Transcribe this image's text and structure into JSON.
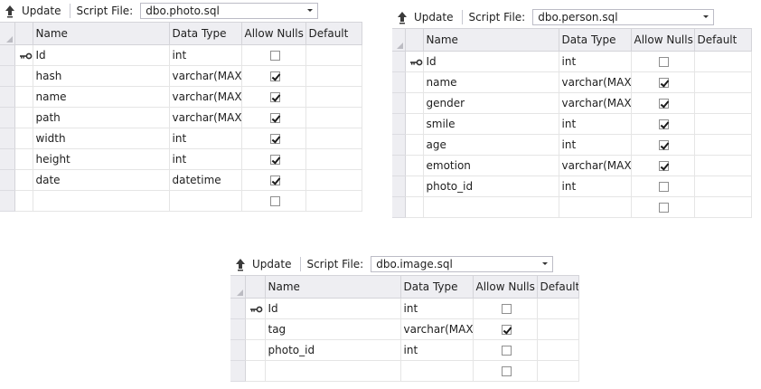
{
  "panels": [
    {
      "id": "photo",
      "toolbar": {
        "update_label": "Update",
        "script_label": "Script File:",
        "script_file": "dbo.photo.sql"
      },
      "columns_header": {
        "name": "Name",
        "data_type": "Data Type",
        "allow_nulls": "Allow Nulls",
        "default": "Default"
      },
      "rows": [
        {
          "key": true,
          "name": "Id",
          "type": "int",
          "nulls": false
        },
        {
          "key": false,
          "name": "hash",
          "type": "varchar(MAX)",
          "nulls": true
        },
        {
          "key": false,
          "name": "name",
          "type": "varchar(MAX)",
          "nulls": true
        },
        {
          "key": false,
          "name": "path",
          "type": "varchar(MAX)",
          "nulls": true
        },
        {
          "key": false,
          "name": "width",
          "type": "int",
          "nulls": true
        },
        {
          "key": false,
          "name": "height",
          "type": "int",
          "nulls": true
        },
        {
          "key": false,
          "name": "date",
          "type": "datetime",
          "nulls": true
        },
        {
          "key": false,
          "name": "",
          "type": "",
          "nulls": false
        }
      ]
    },
    {
      "id": "person",
      "toolbar": {
        "update_label": "Update",
        "script_label": "Script File:",
        "script_file": "dbo.person.sql"
      },
      "columns_header": {
        "name": "Name",
        "data_type": "Data Type",
        "allow_nulls": "Allow Nulls",
        "default": "Default"
      },
      "rows": [
        {
          "key": true,
          "name": "Id",
          "type": "int",
          "nulls": false
        },
        {
          "key": false,
          "name": "name",
          "type": "varchar(MAX)",
          "nulls": true
        },
        {
          "key": false,
          "name": "gender",
          "type": "varchar(MAX)",
          "nulls": true
        },
        {
          "key": false,
          "name": "smile",
          "type": "int",
          "nulls": true
        },
        {
          "key": false,
          "name": "age",
          "type": "int",
          "nulls": true
        },
        {
          "key": false,
          "name": "emotion",
          "type": "varchar(MAX)",
          "nulls": true
        },
        {
          "key": false,
          "name": "photo_id",
          "type": "int",
          "nulls": false
        },
        {
          "key": false,
          "name": "",
          "type": "",
          "nulls": false
        }
      ]
    },
    {
      "id": "image",
      "toolbar": {
        "update_label": "Update",
        "script_label": "Script File:",
        "script_file": "dbo.image.sql"
      },
      "columns_header": {
        "name": "Name",
        "data_type": "Data Type",
        "allow_nulls": "Allow Nulls",
        "default": "Default"
      },
      "rows": [
        {
          "key": true,
          "name": "Id",
          "type": "int",
          "nulls": false
        },
        {
          "key": false,
          "name": "tag",
          "type": "varchar(MAX)",
          "nulls": true
        },
        {
          "key": false,
          "name": "photo_id",
          "type": "int",
          "nulls": false
        },
        {
          "key": false,
          "name": "",
          "type": "",
          "nulls": false
        }
      ]
    }
  ]
}
